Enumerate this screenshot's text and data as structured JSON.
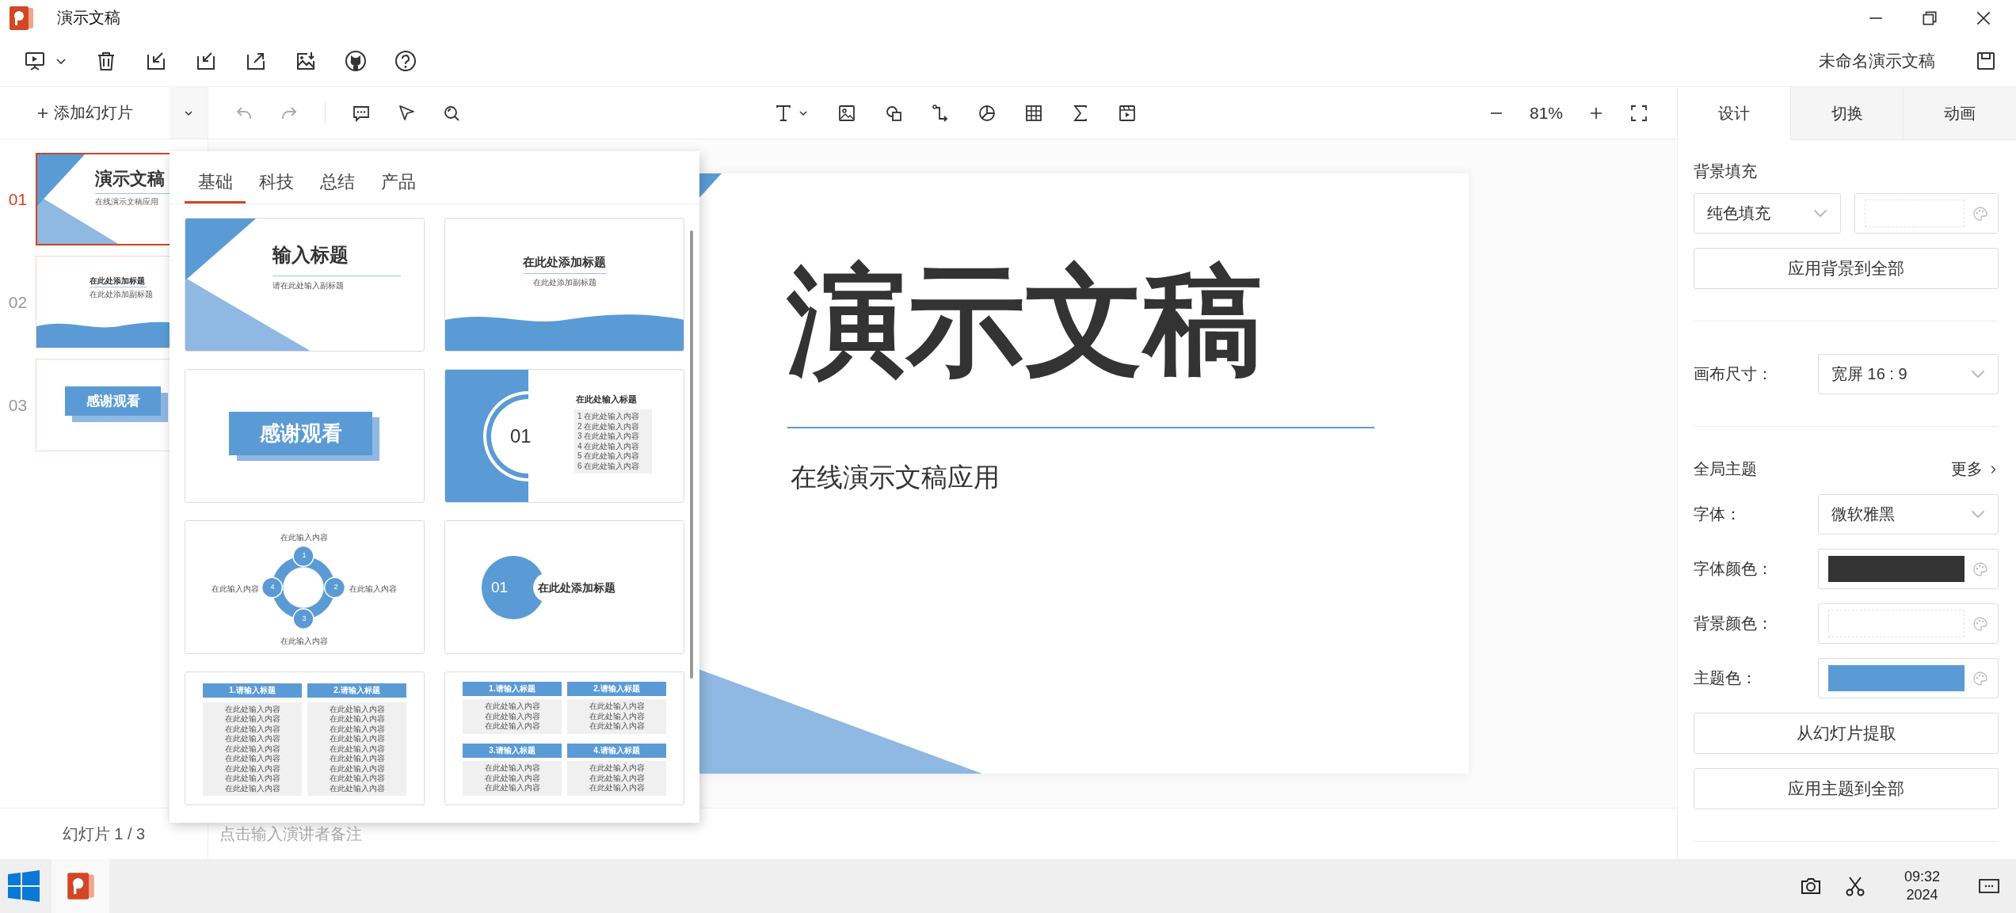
{
  "window": {
    "title": "演示文稿"
  },
  "header": {
    "document_name": "未命名演示文稿"
  },
  "editor_toolbar": {
    "add_slide": "添加幻灯片",
    "zoom": "81%"
  },
  "slides": [
    {
      "number": "01",
      "selected": true,
      "kind": "cover",
      "title": "演示文稿",
      "subtitle": "在线演示文稿应用"
    },
    {
      "number": "02",
      "selected": false,
      "kind": "wave",
      "title": "在此处添加标题",
      "subtitle": "在此处添加副标题"
    },
    {
      "number": "03",
      "selected": false,
      "kind": "thanks",
      "title": "感谢观看"
    }
  ],
  "template_panel": {
    "tabs": [
      {
        "label": "基础",
        "selected": true
      },
      {
        "label": "科技",
        "selected": false
      },
      {
        "label": "总结",
        "selected": false
      },
      {
        "label": "产品",
        "selected": false
      }
    ],
    "templates": [
      {
        "kind": "cover",
        "title": "输入标题",
        "subtitle": "请在此处输入副标题"
      },
      {
        "kind": "wave",
        "title": "在此处添加标题",
        "subtitle": "在此处添加副标题"
      },
      {
        "kind": "thanks",
        "title": "感谢观看"
      },
      {
        "kind": "section",
        "number": "01",
        "title": "在此处输入标题",
        "items": [
          "1 在此处输入内容",
          "2 在此处输入内容",
          "3 在此处输入内容",
          "4 在此处输入内容",
          "5 在此处输入内容",
          "6 在此处输入内容"
        ]
      },
      {
        "kind": "cycle",
        "nodes": [
          {
            "number": "1",
            "label": "在此输入内容"
          },
          {
            "number": "2",
            "label": "在此输入内容"
          },
          {
            "number": "3",
            "label": "在此输入内容"
          },
          {
            "number": "4",
            "label": "在此输入内容"
          }
        ]
      },
      {
        "kind": "chapter",
        "number": "01",
        "title": "在此处添加标题"
      },
      {
        "kind": "two_column",
        "boxes": [
          {
            "title": "1.请输入标题",
            "lines": [
              "在此处输入内容",
              "在此处输入内容",
              "在此处输入内容",
              "在此处输入内容",
              "在此处输入内容",
              "在此处输入内容",
              "在此处输入内容",
              "在此处输入内容",
              "在此处输入内容"
            ]
          },
          {
            "title": "2.请输入标题",
            "lines": [
              "在此处输入内容",
              "在此处输入内容",
              "在此处输入内容",
              "在此处输入内容",
              "在此处输入内容",
              "在此处输入内容",
              "在此处输入内容",
              "在此处输入内容",
              "在此处输入内容"
            ]
          }
        ]
      },
      {
        "kind": "four_box",
        "boxes": [
          {
            "title": "1.请输入标题",
            "lines": [
              "在此处输入内容",
              "在此处输入内容",
              "在此处输入内容"
            ]
          },
          {
            "title": "2.请输入标题",
            "lines": [
              "在此处输入内容",
              "在此处输入内容",
              "在此处输入内容"
            ]
          },
          {
            "title": "3.请输入标题",
            "lines": [
              "在此处输入内容",
              "在此处输入内容",
              "在此处输入内容"
            ]
          },
          {
            "title": "4.请输入标题",
            "lines": [
              "在此处输入内容",
              "在此处输入内容",
              "在此处输入内容"
            ]
          }
        ]
      }
    ]
  },
  "canvas": {
    "title": "演示文稿",
    "subtitle": "在线演示文稿应用"
  },
  "design_panel": {
    "tabs": [
      {
        "label": "设计",
        "selected": true
      },
      {
        "label": "切换",
        "selected": false
      },
      {
        "label": "动画",
        "selected": false
      }
    ],
    "background_fill": {
      "label": "背景填充",
      "fill_type": "纯色填充",
      "apply_button": "应用背景到全部"
    },
    "canvas_size": {
      "label": "画布尺寸：",
      "value": "宽屏 16 : 9"
    },
    "theme": {
      "title": "全局主题",
      "more": "更多",
      "font_label": "字体：",
      "font": "微软雅黑",
      "font_color_label": "字体颜色：",
      "background_color_label": "背景颜色：",
      "theme_color_label": "主题色：",
      "extract_button": "从幻灯片提取",
      "apply_button": "应用主题到全部"
    }
  },
  "notes": {
    "slide_counter": "幻灯片 1 / 3",
    "placeholder": "点击输入演讲者备注"
  },
  "taskbar": {
    "time": "09:32",
    "date": "2024"
  }
}
